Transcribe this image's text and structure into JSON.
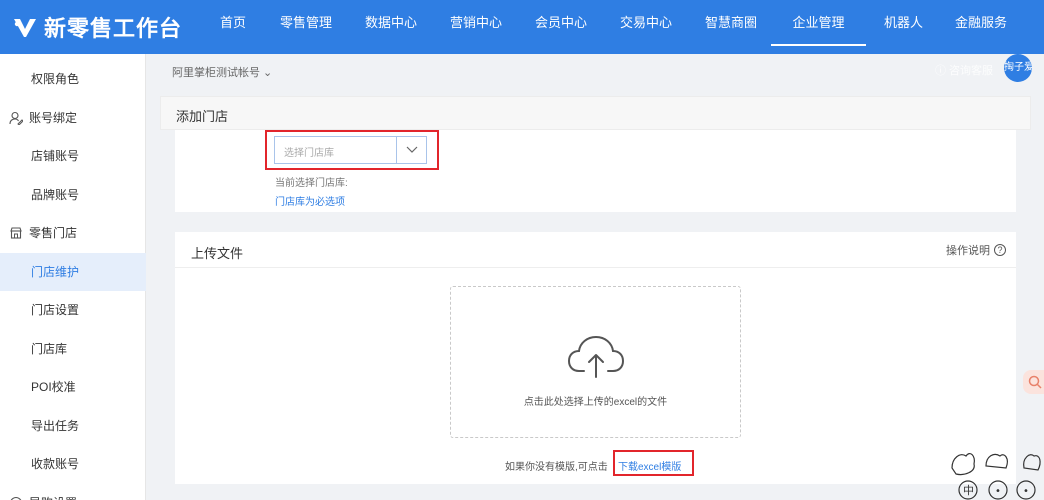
{
  "app": {
    "logo_text": "新零售工作台"
  },
  "nav": {
    "items": [
      {
        "label": "首页",
        "width": 56
      },
      {
        "label": "零售管理",
        "width": 90
      },
      {
        "label": "数据中心",
        "width": 80
      },
      {
        "label": "营销中心",
        "width": 90
      },
      {
        "label": "会员中心",
        "width": 80
      },
      {
        "label": "交易中心",
        "width": 90
      },
      {
        "label": "智慧商圈",
        "width": 80
      },
      {
        "label": "企业管理",
        "width": 95
      },
      {
        "label": "机器人",
        "width": 75
      },
      {
        "label": "金融服务",
        "width": 80
      }
    ],
    "active": "企业管理"
  },
  "sidebar": {
    "items": [
      {
        "label": "权限角色",
        "type": "sub"
      },
      {
        "label": "账号绑定",
        "type": "group",
        "icon": "user-edit-icon"
      },
      {
        "label": "店铺账号",
        "type": "sub"
      },
      {
        "label": "品牌账号",
        "type": "sub"
      },
      {
        "label": "零售门店",
        "type": "group",
        "icon": "store-icon"
      },
      {
        "label": "门店维护",
        "type": "sub",
        "active": true
      },
      {
        "label": "门店设置",
        "type": "sub"
      },
      {
        "label": "门店库",
        "type": "sub"
      },
      {
        "label": "POI校准",
        "type": "sub"
      },
      {
        "label": "导出任务",
        "type": "sub"
      },
      {
        "label": "收款账号",
        "type": "sub"
      },
      {
        "label": "导购设置",
        "type": "group",
        "icon": "guide-icon"
      }
    ]
  },
  "header": {
    "account": "阿里掌柜测试帐号",
    "help_link": "咨询客服",
    "avatar_text": "掏子爱"
  },
  "add_store": {
    "title": "添加门店",
    "select_placeholder": "选择门店库",
    "current_label": "当前选择门店库:",
    "required_note": "门店库为必选项"
  },
  "upload": {
    "title": "上传文件",
    "op_help": "操作说明",
    "drop_text": "点击此处选择上传的excel的文件",
    "template_prefix": "如果你没有模版,可点击",
    "template_link": "下载excel模版"
  },
  "float": {
    "sticker_chars": [
      "中",
      "•",
      "•"
    ]
  },
  "colors": {
    "brand": "#2f7ee3",
    "highlight": "#e2252b"
  }
}
